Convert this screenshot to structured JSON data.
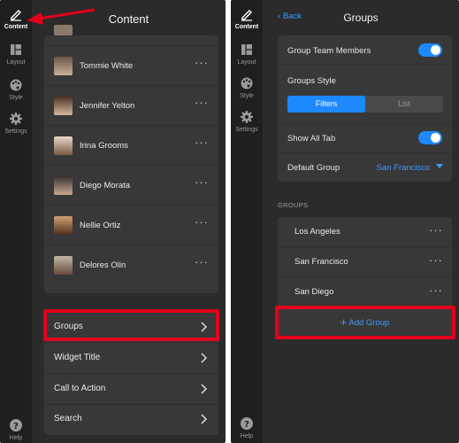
{
  "rail": {
    "content_label": "Content",
    "layout_label": "Layout",
    "style_label": "Style",
    "settings_label": "Settings",
    "help_label": "Help"
  },
  "left": {
    "title": "Content",
    "people": [
      {
        "name": "Tommie White"
      },
      {
        "name": "Jennifer Yelton"
      },
      {
        "name": "Irina Grooms"
      },
      {
        "name": "Diego Morata"
      },
      {
        "name": "Nellie Ortiz"
      },
      {
        "name": "Delores Olin"
      }
    ],
    "menu": [
      {
        "label": "Groups"
      },
      {
        "label": "Widget Title"
      },
      {
        "label": "Call to Action"
      },
      {
        "label": "Search"
      }
    ]
  },
  "right": {
    "back_label": "Back",
    "title": "Groups",
    "settings": {
      "group_team_members": "Group Team Members",
      "groups_style": "Groups Style",
      "style_options": [
        "Filters",
        "List"
      ],
      "show_all_tab": "Show All Tab",
      "default_group": "Default Group",
      "default_group_value": "San Francisco"
    },
    "groups_header": "GROUPS",
    "groups": [
      {
        "label": "Los Angeles"
      },
      {
        "label": "San Francisco"
      },
      {
        "label": "San Diego"
      }
    ],
    "add_group": "Add Group"
  },
  "colors": {
    "accent": "#1e88ff",
    "highlight": "#e3001b",
    "panel_bg": "#2b2b2b",
    "card_bg": "#383838"
  }
}
